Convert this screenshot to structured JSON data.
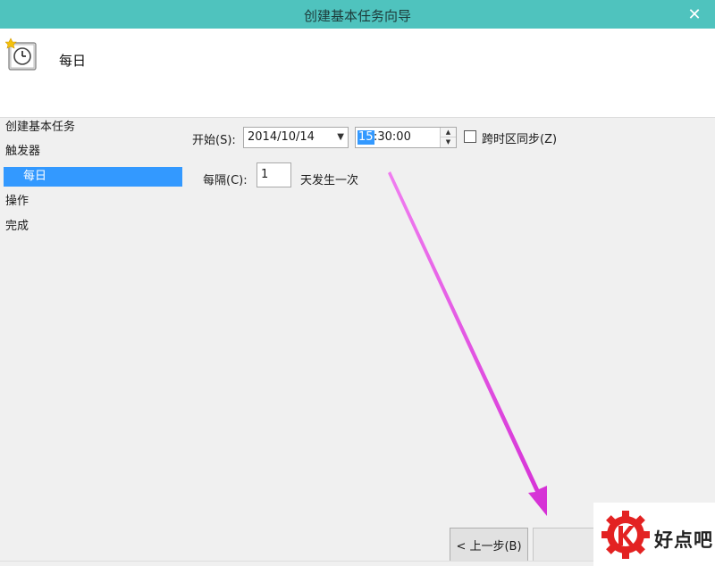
{
  "window": {
    "title": "创建基本任务向导",
    "close_glyph": "✕"
  },
  "header": {
    "title": "每日",
    "icon": "task-scheduler-clock-icon"
  },
  "sidebar": {
    "items": [
      {
        "label": "创建基本任务"
      },
      {
        "label": "触发器"
      },
      {
        "label": "每日",
        "selected": true
      },
      {
        "label": "操作"
      },
      {
        "label": "完成"
      }
    ]
  },
  "form": {
    "start_label": "开始(S):",
    "start_date": "2014/10/14",
    "start_hour": "15",
    "start_time_rest": ":30:00",
    "sync_timezone_label": "跨时区同步(Z)",
    "sync_timezone_checked": false,
    "recur_label": "每隔(C):",
    "recur_value": "1",
    "recur_unit": "天发生一次"
  },
  "footer": {
    "back_label": "< 上一步(B)"
  },
  "watermark": {
    "text": "好点吧"
  },
  "colors": {
    "titlebar": "#4fc3be",
    "selection": "#3399ff",
    "annotation_arrow": "#e040e0",
    "watermark_red": "#e32222"
  }
}
